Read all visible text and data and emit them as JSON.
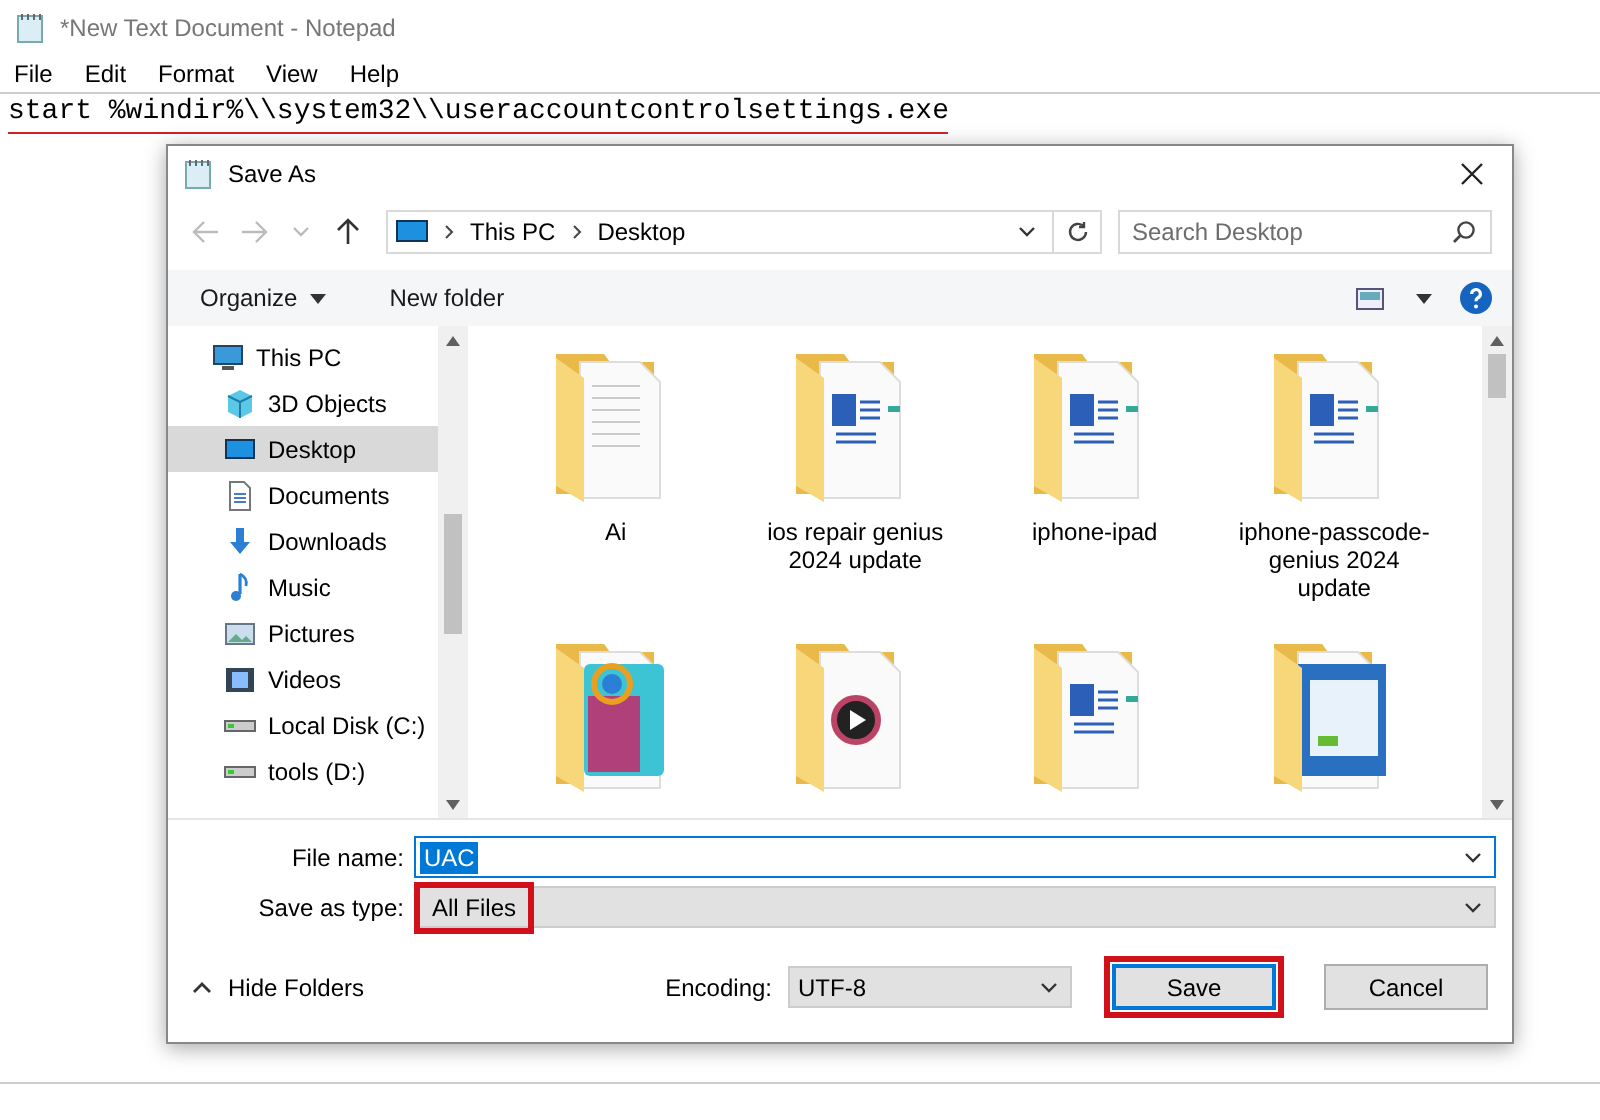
{
  "notepad": {
    "title": "*New Text Document - Notepad",
    "menu": [
      "File",
      "Edit",
      "Format",
      "View",
      "Help"
    ],
    "text": "start %windir%\\\\system32\\\\useraccountcontrolsettings.exe",
    "underlined": true
  },
  "dialog": {
    "title": "Save As",
    "breadcrumb": [
      "This PC",
      "Desktop"
    ],
    "search": {
      "placeholder": "Search Desktop"
    },
    "toolbar": {
      "organize": "Organize",
      "new_folder": "New folder"
    },
    "nav": [
      {
        "label": "This PC",
        "kind": "pc",
        "selected": false,
        "children": [
          {
            "label": "3D Objects",
            "kind": "cube",
            "selected": false
          },
          {
            "label": "Desktop",
            "kind": "desktop",
            "selected": true
          },
          {
            "label": "Documents",
            "kind": "documents",
            "selected": false
          },
          {
            "label": "Downloads",
            "kind": "downloads",
            "selected": false
          },
          {
            "label": "Music",
            "kind": "music",
            "selected": false
          },
          {
            "label": "Pictures",
            "kind": "pictures",
            "selected": false
          },
          {
            "label": "Videos",
            "kind": "videos",
            "selected": false
          },
          {
            "label": "Local Disk (C:)",
            "kind": "drive",
            "selected": false
          },
          {
            "label": "tools (D:)",
            "kind": "drive",
            "selected": false
          }
        ]
      }
    ],
    "folders": [
      {
        "name": "Ai",
        "kind": "pages"
      },
      {
        "name": "ios repair genius 2024 update",
        "kind": "word"
      },
      {
        "name": "iphone-ipad",
        "kind": "word"
      },
      {
        "name": "iphone-passcode-genius 2024 update",
        "kind": "word"
      },
      {
        "kind": "app"
      },
      {
        "kind": "video"
      },
      {
        "kind": "word"
      },
      {
        "kind": "web"
      }
    ],
    "file_name": {
      "label": "File name:",
      "value": "UAC",
      "value_selected": true
    },
    "save_type": {
      "label": "Save as type:",
      "value": "All Files",
      "highlighted": true
    },
    "hide_folders": "Hide Folders",
    "encoding": {
      "label": "Encoding:",
      "value": "UTF-8"
    },
    "buttons": [
      {
        "label": "Save",
        "default": true,
        "highlighted": true
      },
      {
        "label": "Cancel",
        "default": false,
        "highlighted": false
      }
    ]
  }
}
